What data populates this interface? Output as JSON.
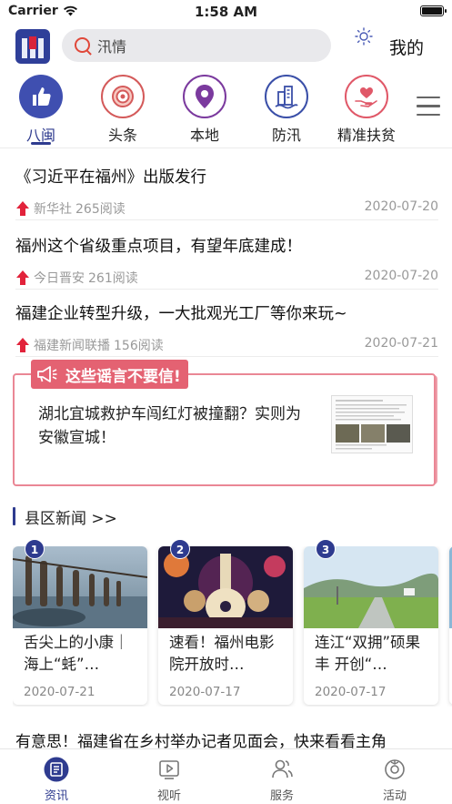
{
  "status": {
    "carrier": "Carrier",
    "time": "1:58 AM"
  },
  "header": {
    "search_text": "汛情",
    "mine_label": "我的"
  },
  "channels": [
    {
      "label": "八闽",
      "icon": "thumbs-up-icon",
      "color": "#3f4fb0",
      "active": true
    },
    {
      "label": "头条",
      "icon": "target-icon",
      "color": "#d45a5a"
    },
    {
      "label": "本地",
      "icon": "location-pin-icon",
      "color": "#7b3a9e"
    },
    {
      "label": "防汛",
      "icon": "buildings-icon",
      "color": "#3a4fa8"
    },
    {
      "label": "精准扶贫",
      "icon": "heart-hand-icon",
      "color": "#e05868"
    }
  ],
  "news": [
    {
      "title": "《习近平在福州》出版发行",
      "source": "新华社",
      "reads": "265阅读",
      "date": "2020-07-20"
    },
    {
      "title": "福州这个省级重点项目，有望年底建成！",
      "source": "今日晋安",
      "reads": "261阅读",
      "date": "2020-07-20"
    },
    {
      "title": "福建企业转型升级，一大批观光工厂等你来玩~",
      "source": "福建新闻联播",
      "reads": "156阅读",
      "date": "2020-07-21"
    }
  ],
  "rumor": {
    "tag": "这些谣言不要信!",
    "text": "湖北宜城救护车闯红灯被撞翻？实则为安徽宣城！"
  },
  "county": {
    "title": "县区新闻 >>",
    "cards": [
      {
        "rank": "1",
        "title": "舌尖上的小康｜海上“蚝”…",
        "date": "2020-07-21"
      },
      {
        "rank": "2",
        "title": "速看！福州电影院开放时…",
        "date": "2020-07-17"
      },
      {
        "rank": "3",
        "title": "连江“双拥”硕果丰 开创“…",
        "date": "2020-07-17"
      }
    ]
  },
  "bottom_news": "有意思！福建省在乡村举办记者见面会，快来看看主角",
  "tabs": [
    {
      "label": "资讯",
      "icon": "news-icon",
      "active": true
    },
    {
      "label": "视听",
      "icon": "video-icon"
    },
    {
      "label": "服务",
      "icon": "people-icon"
    },
    {
      "label": "活动",
      "icon": "activity-icon"
    }
  ]
}
